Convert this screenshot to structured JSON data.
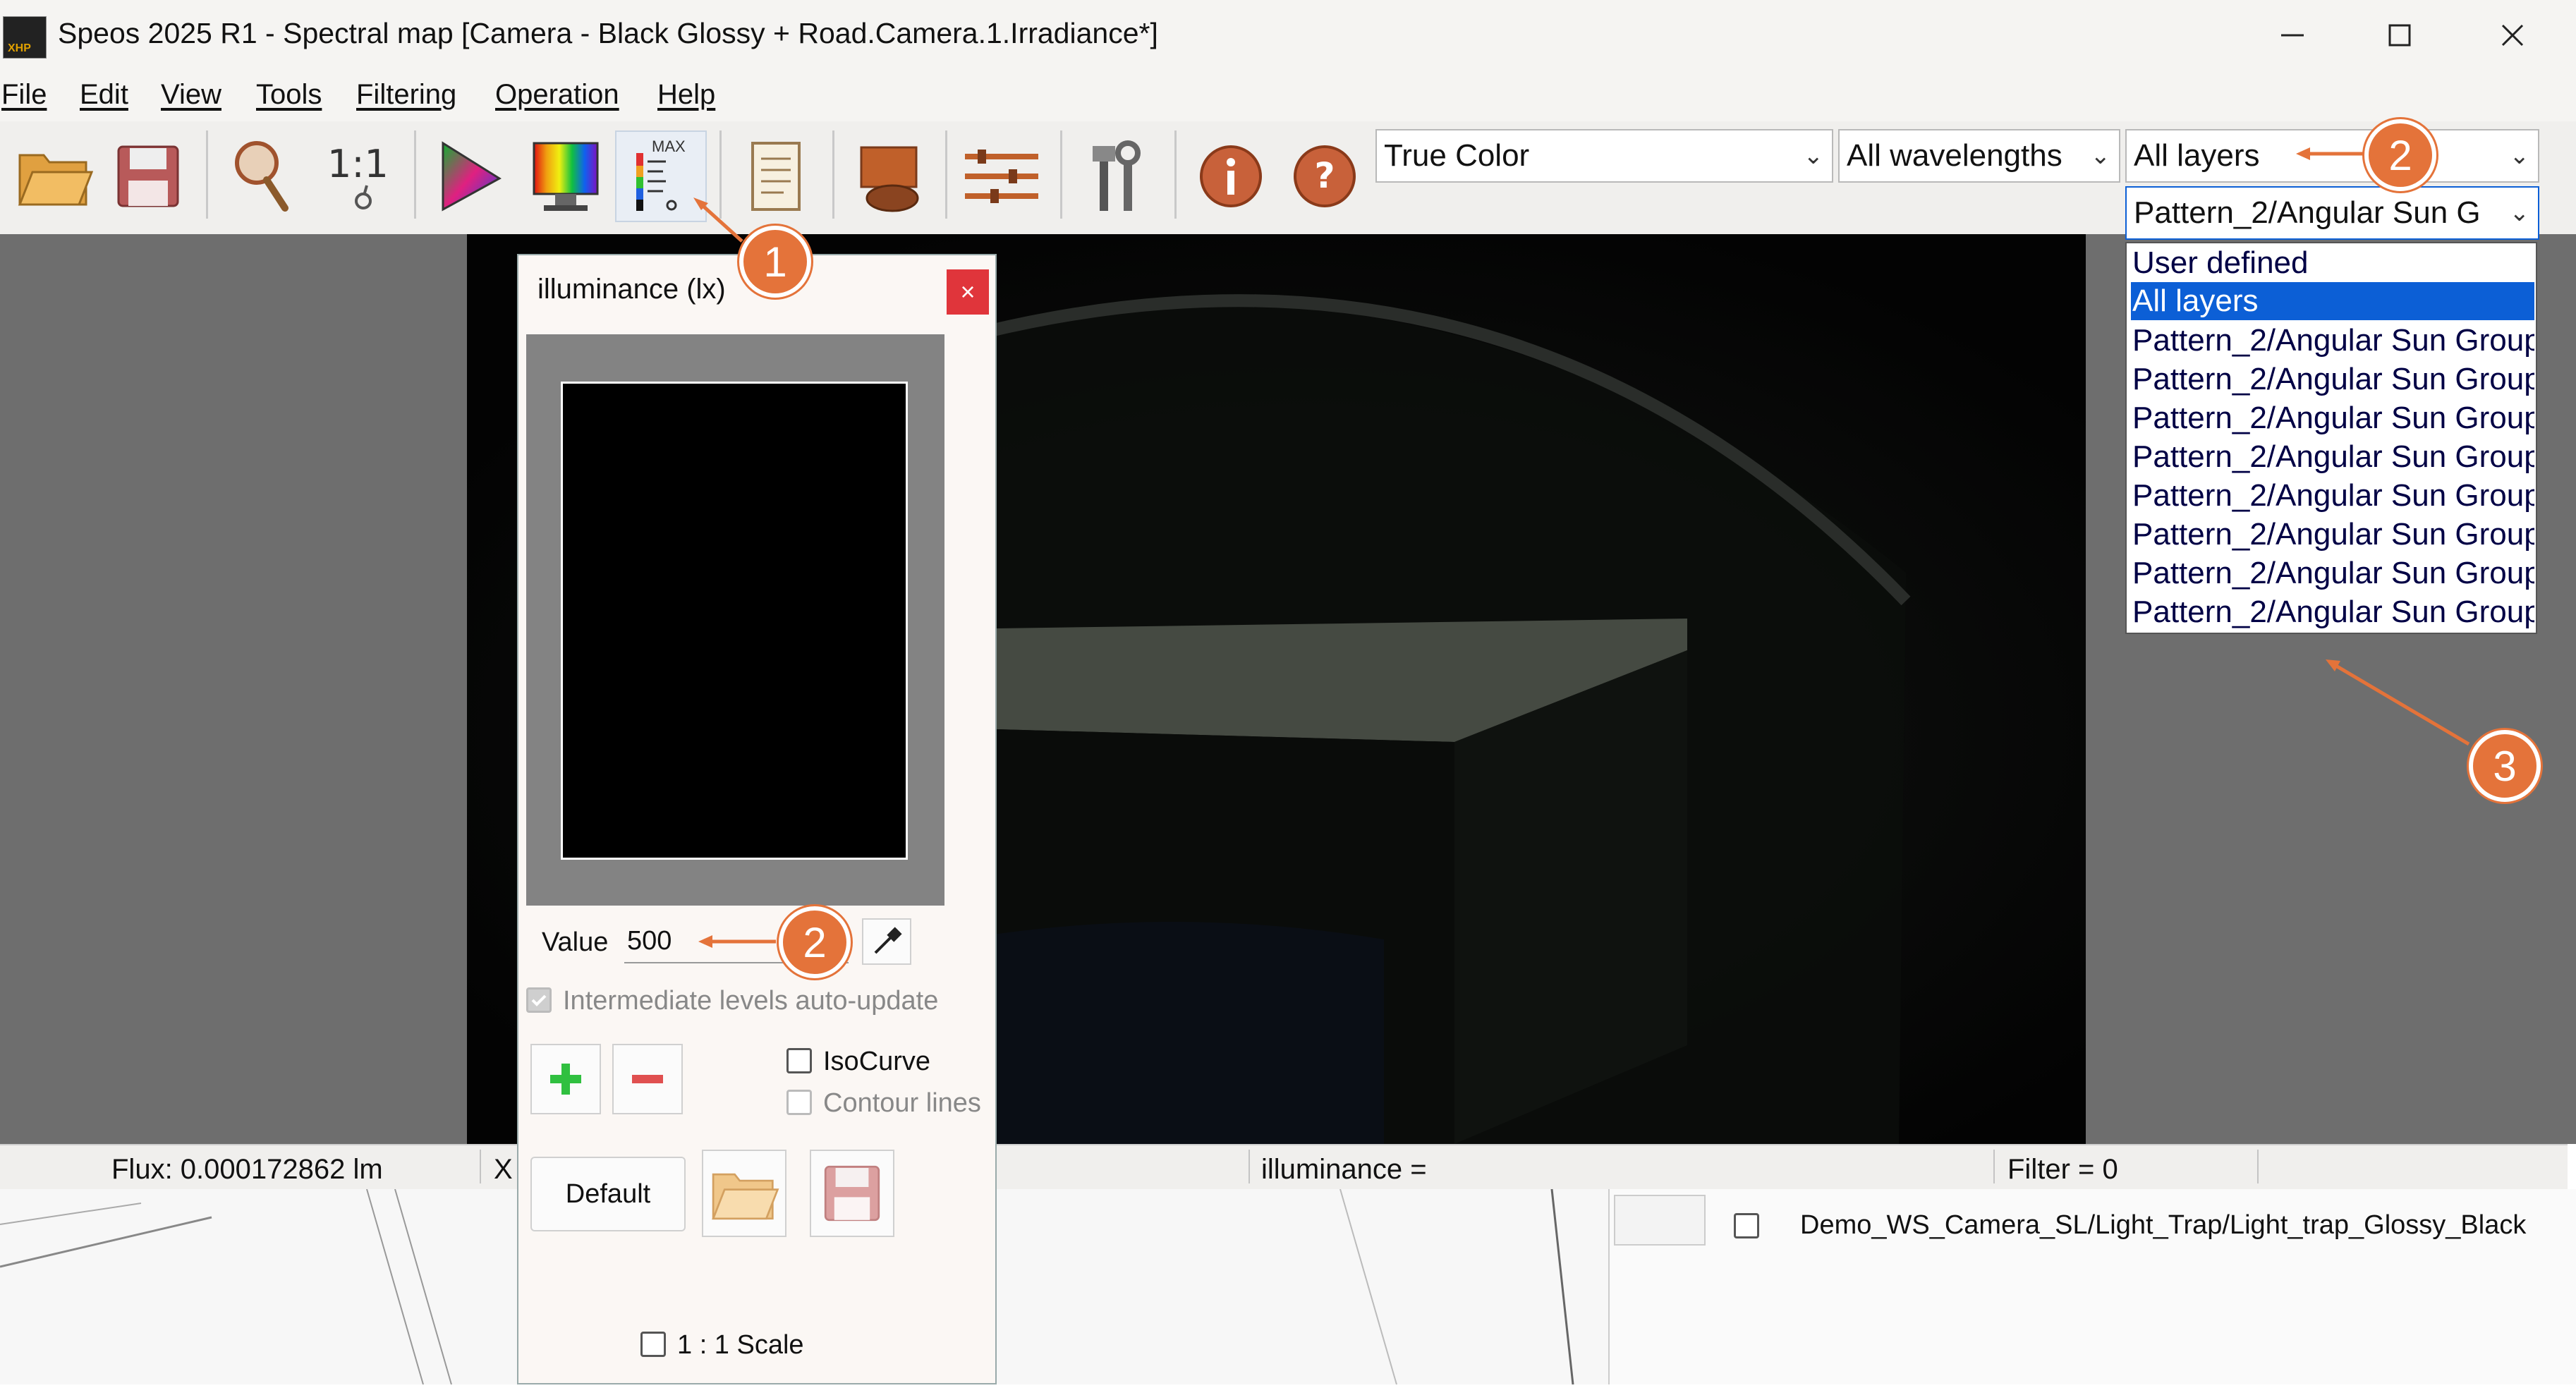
{
  "window": {
    "title": "Speos 2025 R1 - Spectral map [Camera - Black Glossy + Road.Camera.1.Irradiance*]",
    "minimize_icon": "minimize-icon",
    "maximize_icon": "maximize-icon",
    "close_icon": "close-icon"
  },
  "menu": {
    "items": [
      "File",
      "Edit",
      "View",
      "Tools",
      "Filtering",
      "Operation",
      "Help"
    ]
  },
  "toolbar": {
    "buttons": [
      {
        "name": "open-folder-icon"
      },
      {
        "name": "save-icon"
      },
      {
        "name": "zoom-icon"
      },
      {
        "name": "one-to-one-icon",
        "label": "1:1"
      },
      {
        "name": "color-triangle-icon"
      },
      {
        "name": "spectrum-display-icon"
      },
      {
        "name": "max-scale-icon",
        "label": "MAX"
      },
      {
        "name": "report-icon"
      },
      {
        "name": "layer-icon"
      },
      {
        "name": "settings-sliders-icon"
      },
      {
        "name": "tools-icon"
      },
      {
        "name": "info-icon"
      },
      {
        "name": "help-icon"
      }
    ],
    "color_mode": "True Color",
    "wavelength": "All wavelengths",
    "layer": "All layers",
    "layer_sub": "Pattern_2/Angular Sun G"
  },
  "layer_dropdown": {
    "options": [
      "User defined",
      "All layers",
      "Pattern_2/Angular Sun Group",
      "Pattern_2/Angular Sun Group",
      "Pattern_2/Angular Sun Group",
      "Pattern_2/Angular Sun Group",
      "Pattern_2/Angular Sun Group",
      "Pattern_2/Angular Sun Group",
      "Pattern_2/Angular Sun Group",
      "Pattern_2/Angular Sun Group"
    ],
    "selected_index": 1
  },
  "dialog": {
    "title": "illuminance (lx)",
    "close": "×",
    "value_label": "Value",
    "value": "500",
    "auto_update_label": "Intermediate levels auto-update",
    "isocurve_label": "IsoCurve",
    "contour_label": "Contour lines",
    "default_label": "Default",
    "scale_label": "1 : 1 Scale"
  },
  "status": {
    "flux": "Flux: 0.000172862 lm",
    "x": "X",
    "illuminance": "illuminance =",
    "filter": "Filter = 0"
  },
  "background_app": {
    "tree_item": "Demo_WS_Camera_SL/Light_Trap/Light_trap_Glossy_Black"
  },
  "annotations": [
    "1",
    "2",
    "2",
    "3"
  ],
  "colors": {
    "accent": "#e4733a",
    "selection": "#0c5fd6"
  }
}
